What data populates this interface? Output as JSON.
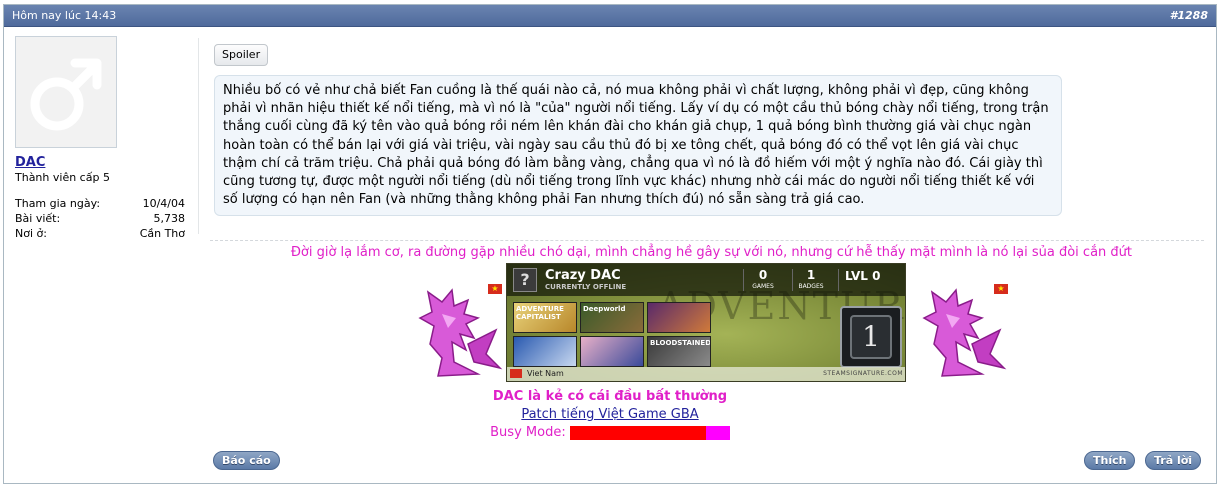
{
  "post": {
    "time": "Hôm nay lúc 14:43",
    "number": "#1288"
  },
  "user": {
    "name": "DAC",
    "title": "Thành viên cấp 5",
    "avatar_icon": "male-symbol-icon",
    "stats": [
      {
        "label": "Tham gia ngày:",
        "value": "10/4/04"
      },
      {
        "label": "Bài viết:",
        "value": "5,738"
      },
      {
        "label": "Nơi ở:",
        "value": "Cần Thơ"
      }
    ]
  },
  "content": {
    "spoiler_label": "Spoiler",
    "spoiler_text": "Nhiều bố có vẻ như chả biết Fan cuồng là thế quái nào cả, nó mua không phải vì chất lượng, không phải vì đẹp, cũng không phải vì nhãn hiệu thiết kế nổi tiếng, mà vì nó là \"của\" người nổi tiếng. Lấy ví dụ có một cầu thủ bóng chày nổi tiếng, trong trận thắng cuối cùng đã ký tên vào quả bóng rồi ném lên khán đài cho khán giả chụp, 1 quả bóng bình thường giá vài chục ngàn hoàn toàn có thể bán lại với giá vài triệu, vài ngày sau cầu thủ đó bị xe tông chết, quả bóng đó có thể vọt lên giá vài chục thậm chí cả trăm triệu. Chả phải quả bóng đó làm bằng vàng, chẳng qua vì nó là đồ hiếm với một ý nghĩa nào đó. Cái giày thì cũng tương tự, được một người nổi tiếng (dù nổi tiếng trong lĩnh vực khác) nhưng nhờ cái mác do người nổi tiếng thiết kế với số lượng có hạn nên Fan (và những thằng không phải Fan nhưng thích đú) nó sẵn sàng trả giá cao."
  },
  "signature": {
    "quote": "Đời giờ lạ lắm cơ, ra đường gặp nhiều chó dại, mình chẳng hề gây sự với nó, nhưng cứ hễ thấy mặt mình là nó lại sủa đòi cắn đứt",
    "steam_card": {
      "name": "Crazy DAC",
      "status": "CURRENTLY OFFLINE",
      "games_value": "0",
      "games_label": "GAMES",
      "badges_value": "1",
      "badges_label": "BADGES",
      "level_text": "LVL 0",
      "level_badge": "1",
      "background_text": "ADVENTURE",
      "country": "Viet Nam",
      "site": "STEAMSIGNATURE.COM",
      "games": [
        "ADVENTURE CAPITALIST",
        "Deepworld",
        "",
        "",
        "",
        "BLOODSTAINED"
      ]
    },
    "tagline": "DAC là kẻ có cái đầu bất thường",
    "patch_link": "Patch tiếng Việt Game GBA",
    "busy_label": "Busy Mode:",
    "busy_level": 0.85
  },
  "actions": {
    "report": "Báo cáo",
    "like": "Thích",
    "reply": "Trả lời"
  },
  "colors": {
    "header": "#5a75a6",
    "accent_magenta": "#e020c8",
    "link": "#22229c",
    "busy_fill": "#ff0000",
    "busy_track": "#ff00ff"
  }
}
